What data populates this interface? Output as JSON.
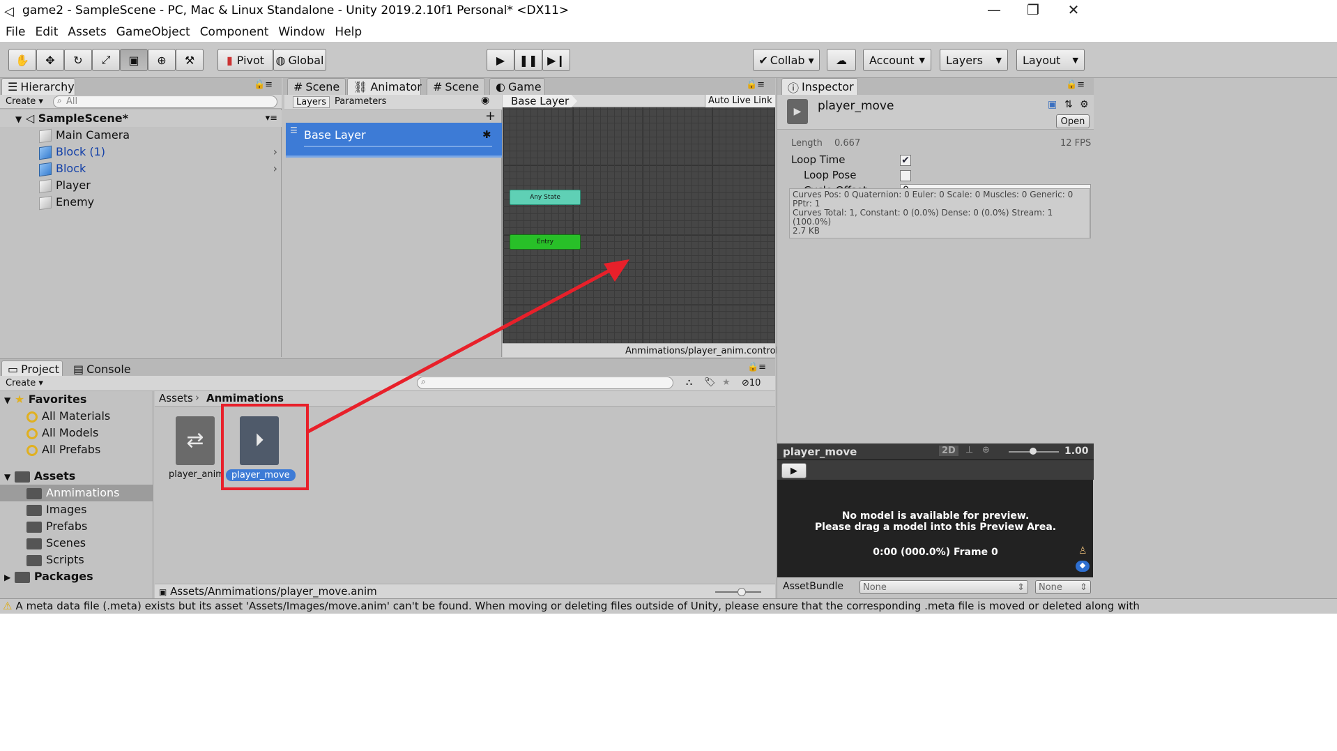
{
  "window": {
    "title": "game2 - SampleScene - PC, Mac & Linux Standalone - Unity 2019.2.10f1 Personal* <DX11>",
    "min": "—",
    "max": "❐",
    "close": "✕"
  },
  "menu": [
    "File",
    "Edit",
    "Assets",
    "GameObject",
    "Component",
    "Window",
    "Help"
  ],
  "toolbar": {
    "pivot": "Pivot",
    "global": "Global",
    "collab": "Collab ▾",
    "account": "Account",
    "layers": "Layers",
    "layout": "Layout"
  },
  "hierarchy": {
    "tab": "Hierarchy",
    "create": "Create ▾",
    "search_placeholder": "All",
    "scene": "SampleScene*",
    "items": [
      "Main Camera",
      "Block (1)",
      "Block",
      "Player",
      "Enemy"
    ]
  },
  "center_tabs": [
    "Scene",
    "Animator",
    "Scene",
    "Game"
  ],
  "animator": {
    "layers_tab": "Layers",
    "parameters_tab": "Parameters",
    "base_layer": "Base Layer",
    "breadcrumb": "Base Layer",
    "auto_live_link": "Auto Live Link",
    "any_state": "Any State",
    "entry": "Entry",
    "path": "Anmimations/player_anim.controller"
  },
  "inspector": {
    "tab": "Inspector",
    "asset_name": "player_move",
    "open": "Open",
    "length_label": "Length",
    "length_value": "0.667",
    "fps": "12 FPS",
    "loop_time": "Loop Time",
    "loop_pose": "Loop Pose",
    "cycle_offset": "Cycle Offset",
    "cycle_offset_value": "0",
    "info": [
      "Curves Pos: 0 Quaternion: 0 Euler: 0 Scale: 0 Muscles: 0 Generic: 0",
      "PPtr: 1",
      "Curves Total: 1, Constant: 0 (0.0%) Dense: 0 (0.0%) Stream: 1",
      "(100.0%)",
      "2.7 KB"
    ],
    "loop_time_checked": true,
    "loop_pose_checked": false
  },
  "preview": {
    "name": "player_move",
    "mode": "2D",
    "speed": "1.00",
    "msg1": "No model is available for preview.",
    "msg2": "Please drag a model into this Preview Area.",
    "time": "0:00 (000.0%) Frame 0"
  },
  "assetbundle": {
    "label": "AssetBundle",
    "name": "None",
    "variant": "None"
  },
  "project": {
    "tab": "Project",
    "console_tab": "Console",
    "create": "Create ▾",
    "badge": "10",
    "favorites": "Favorites",
    "fav_items": [
      "All Materials",
      "All Models",
      "All Prefabs"
    ],
    "assets": "Assets",
    "asset_folders": [
      "Anmimations",
      "Images",
      "Prefabs",
      "Scenes",
      "Scripts"
    ],
    "packages": "Packages",
    "breadcrumb_root": "Assets",
    "breadcrumb_current": "Anmimations",
    "files": [
      "player_anim",
      "player_move"
    ],
    "status_path": "Assets/Anmimations/player_move.anim"
  },
  "statusbar": {
    "message": "A meta data file (.meta) exists but its asset 'Assets/Images/move.anim' can't be found. When moving or deleting files outside of Unity, please ensure that the corresponding .meta file is moved or deleted along with"
  },
  "colors": {
    "selection": "#3d7bd6",
    "any_state": "#5fd0b5",
    "entry": "#28c028",
    "annotation": "#e8202a",
    "grid": "#444444"
  }
}
